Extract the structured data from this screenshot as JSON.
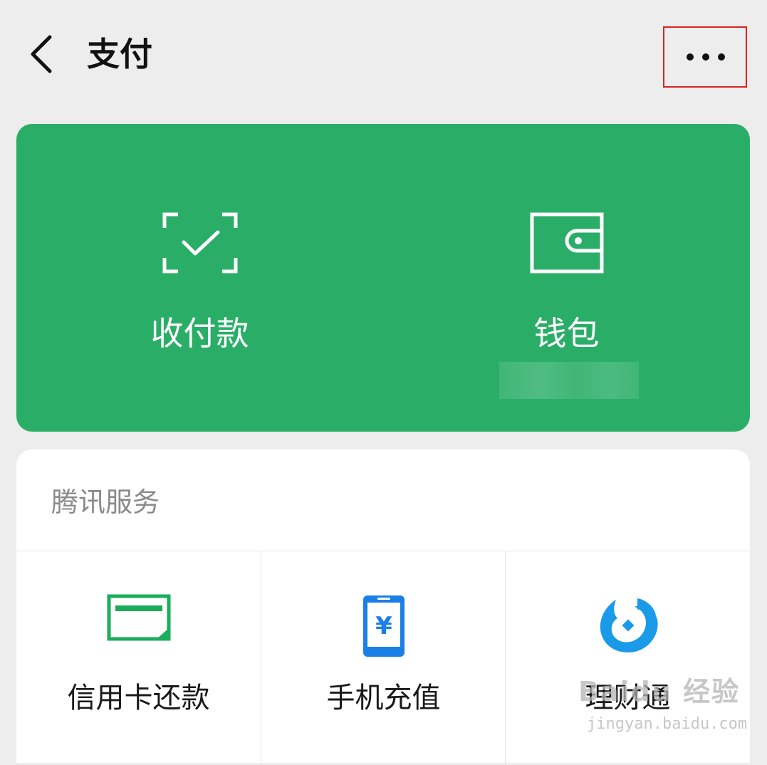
{
  "header": {
    "title": "支付",
    "back_icon": "chevron-left-icon",
    "more_icon": "more-dots-icon"
  },
  "actions": [
    {
      "label": "收付款",
      "icon": "scan-check-icon"
    },
    {
      "label": "钱包",
      "icon": "wallet-icon"
    }
  ],
  "services": {
    "section_title": "腾讯服务",
    "items": [
      {
        "label": "信用卡还款",
        "icon": "credit-card-icon",
        "color": "#1aad5a"
      },
      {
        "label": "手机充值",
        "icon": "phone-recharge-icon",
        "color": "#1a7fe6"
      },
      {
        "label": "理财通",
        "icon": "licaitong-icon",
        "color": "#1a9ae8"
      }
    ]
  },
  "watermark": {
    "text": "Baidu 经验",
    "url": "jingyan.baidu.com"
  },
  "colors": {
    "brand_green": "#2aae67",
    "highlight_border": "#e02020",
    "background": "#ededed"
  }
}
